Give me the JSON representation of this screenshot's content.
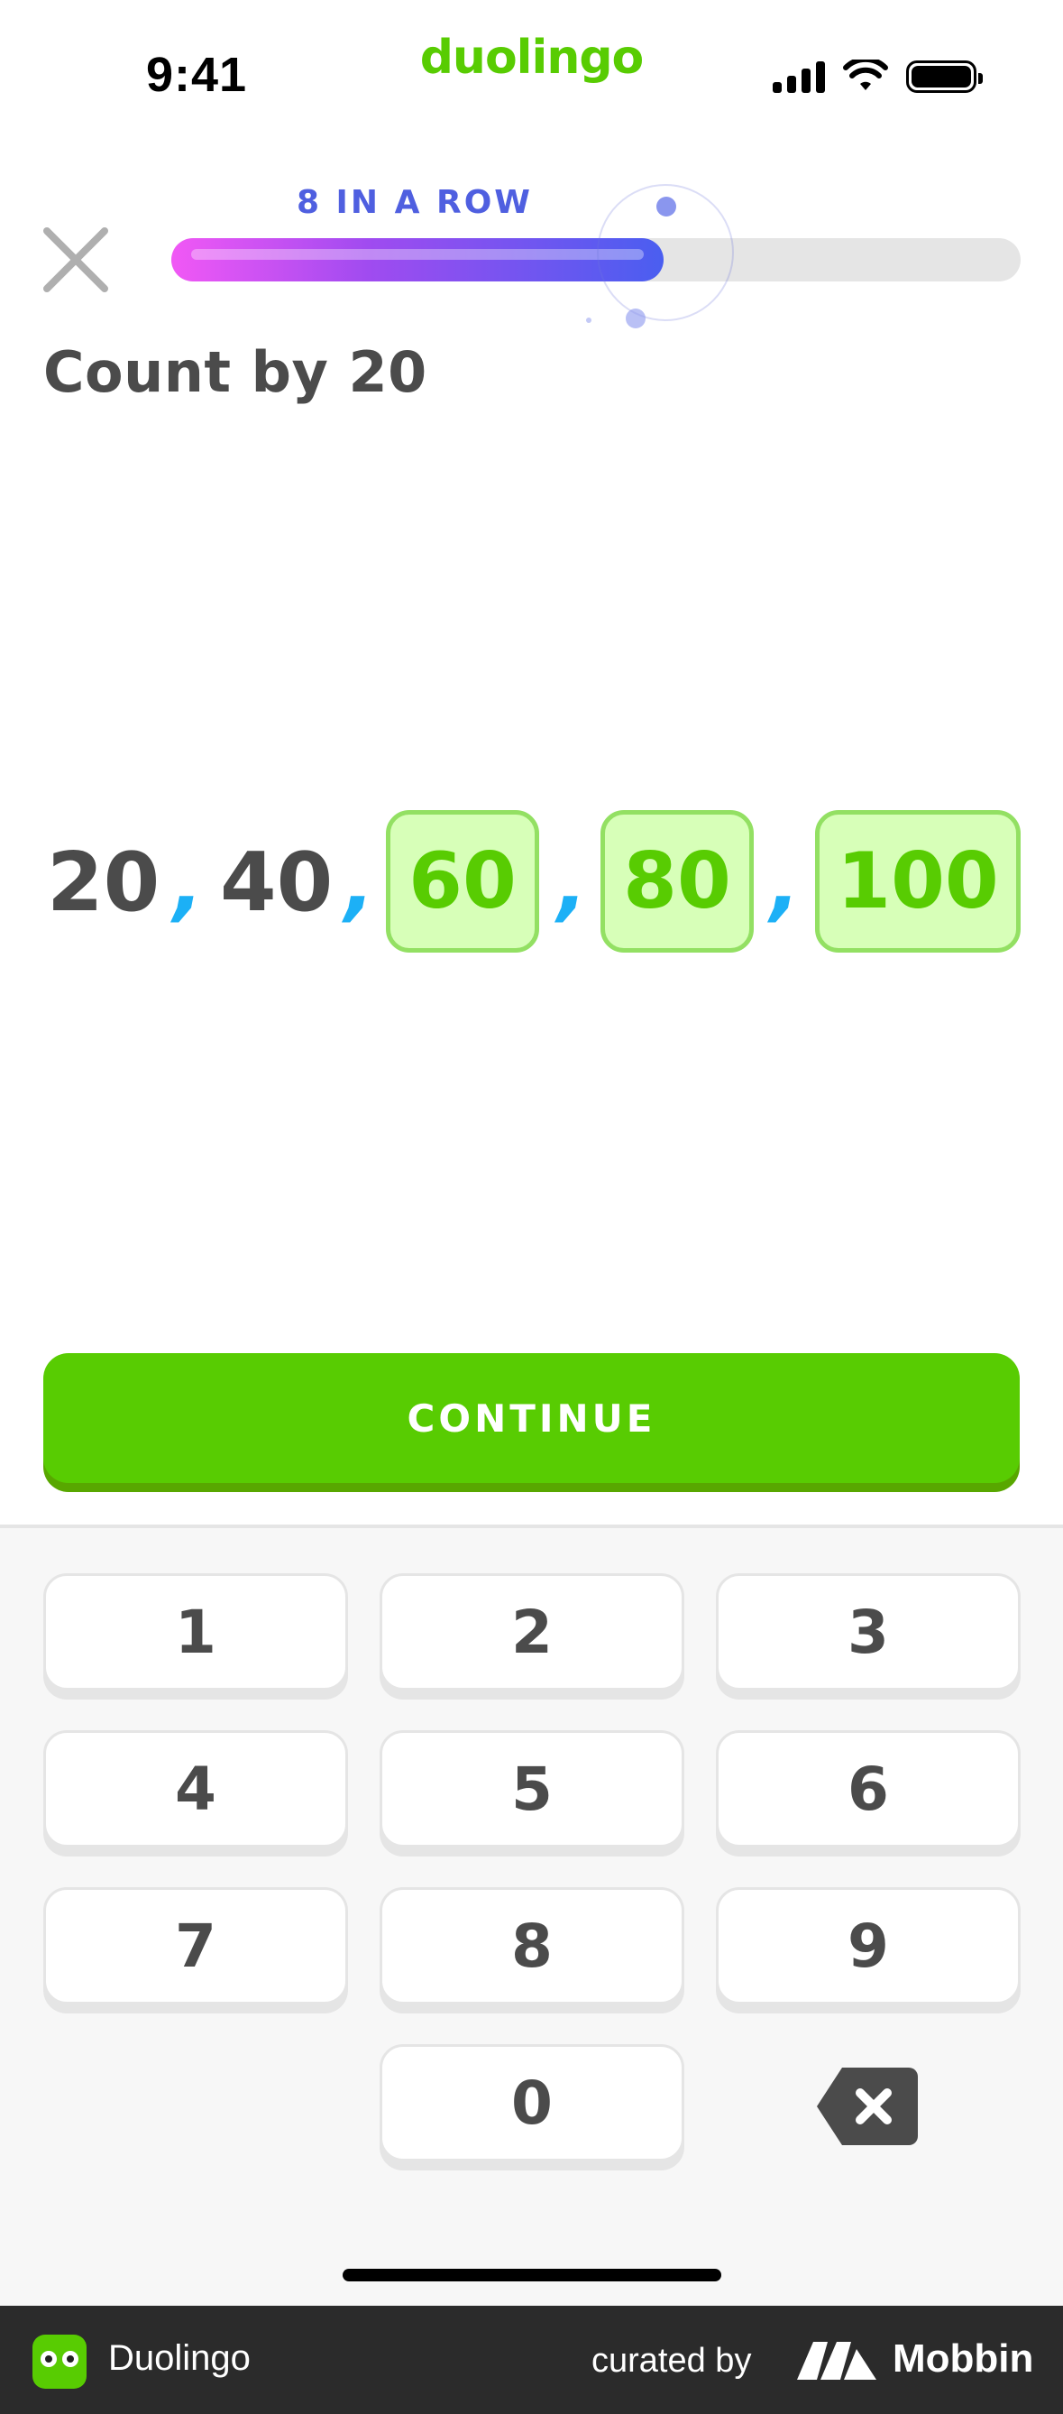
{
  "status_bar": {
    "time": "9:41",
    "brand": "duolingo"
  },
  "lesson": {
    "streak_label": "8 IN A ROW",
    "progress": 0.58,
    "prompt": "Count by 20"
  },
  "sequence": {
    "given": [
      "20",
      "40"
    ],
    "answers": [
      "60",
      "80",
      "100"
    ],
    "separator": ","
  },
  "continue_label": "CONTINUE",
  "keypad": {
    "keys": [
      "1",
      "2",
      "3",
      "4",
      "5",
      "6",
      "7",
      "8",
      "9",
      "0"
    ]
  },
  "footer": {
    "app_name": "Duolingo",
    "curated_by": "curated by",
    "brand": "Mobbin"
  },
  "colors": {
    "accent_green": "#58cc02",
    "streak_blue": "#4f5fe0",
    "comma_blue": "#1cb0f6",
    "answer_bg": "#d7ffb8"
  }
}
